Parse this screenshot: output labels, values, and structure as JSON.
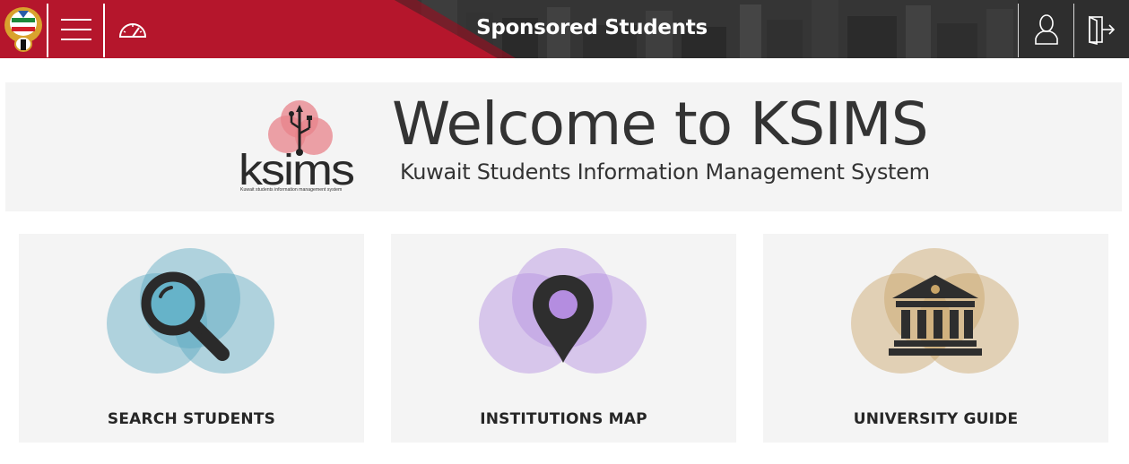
{
  "header": {
    "title": "Sponsored Students",
    "brand_red": "#b5162c",
    "menu_icon": "hamburger-menu-icon",
    "dashboard_icon": "speedometer-icon",
    "profile_icon": "user-icon",
    "logout_icon": "logout-door-icon"
  },
  "banner": {
    "heading": "Welcome to KSIMS",
    "subheading": "Kuwait Students Information Management System",
    "logo_text": "ksims",
    "logo_tagline": "Kuwait students information management system"
  },
  "cards": [
    {
      "label": "SEARCH STUDENTS",
      "icon": "magnifier-icon",
      "color": "#5aa8c0"
    },
    {
      "label": "INSTITUTIONS MAP",
      "icon": "map-pin-icon",
      "color": "#b48de0"
    },
    {
      "label": "UNIVERSITY GUIDE",
      "icon": "university-building-icon",
      "color": "#c9a568"
    }
  ]
}
